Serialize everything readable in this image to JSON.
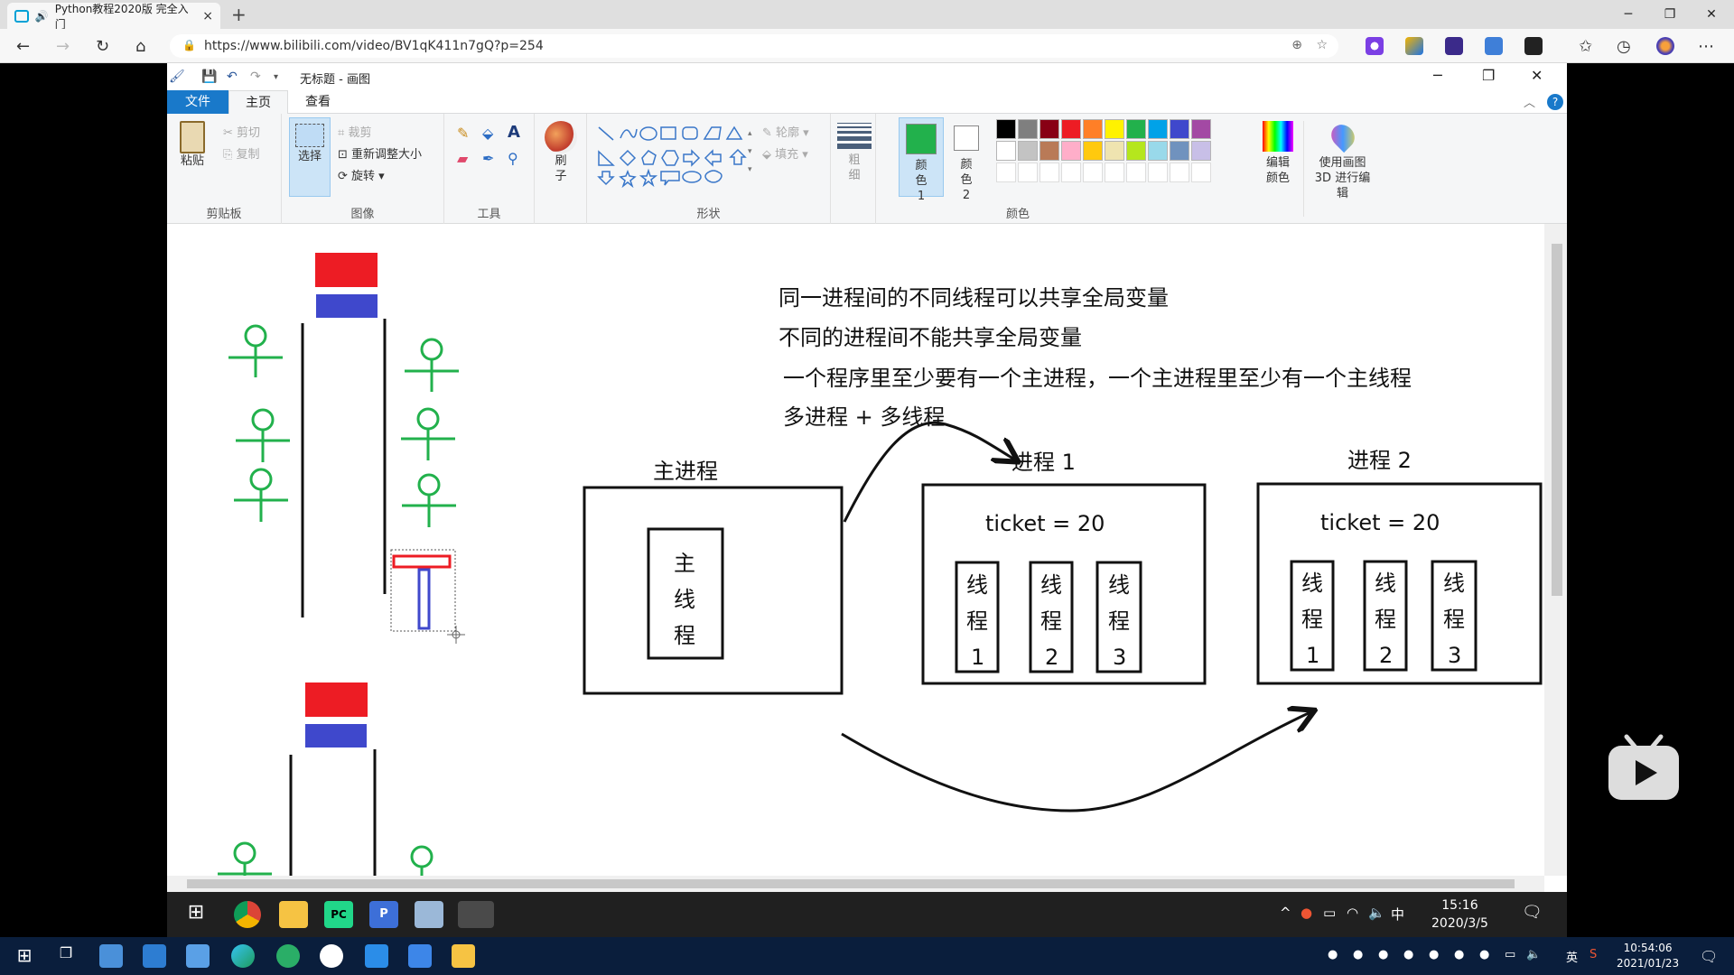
{
  "browser": {
    "tab_title": "Python教程2020版 完全入门",
    "tab_close": "×",
    "new_tab": "+",
    "url": "https://www.bilibili.com/video/BV1qK411n7gQ?p=254",
    "win_min": "─",
    "win_max": "❐",
    "win_close": "✕",
    "back": "←",
    "forward": "→",
    "refresh": "↻",
    "home": "⌂",
    "menu": "⋯"
  },
  "paint": {
    "doc_title": "无标题 - 画图",
    "menu": {
      "file": "文件",
      "home": "主页",
      "view": "查看"
    },
    "help": "?",
    "ribbon": {
      "clipboard": {
        "label": "剪贴板",
        "paste": "粘贴",
        "cut": "剪切",
        "copy": "复制"
      },
      "image": {
        "label": "图像",
        "select": "选择",
        "crop": "裁剪",
        "resize": "重新调整大小",
        "rotate": "旋转"
      },
      "tools": {
        "label": "工具"
      },
      "brushes": {
        "label": "刷子"
      },
      "shapes": {
        "label": "形状",
        "outline": "轮廓",
        "fill": "填充"
      },
      "size": {
        "label": "粗细"
      },
      "color1": "颜色 1",
      "color2": "颜色 2",
      "colors": {
        "label": "颜色",
        "edit": "编辑颜色"
      },
      "paint3d": "使用画图 3D 进行编辑"
    },
    "palette_row1": [
      "#000000",
      "#7f7f7f",
      "#880015",
      "#ed1c24",
      "#ff7f27",
      "#fff200",
      "#22b14c",
      "#00a2e8",
      "#3f48cc",
      "#a349a4"
    ],
    "palette_row2": [
      "#ffffff",
      "#c3c3c3",
      "#b97a57",
      "#ffaec9",
      "#ffc90e",
      "#efe4b0",
      "#b5e61d",
      "#99d9ea",
      "#7092be",
      "#c8bfe7"
    ],
    "color1_value": "#22b14c",
    "color2_value": "#ffffff"
  },
  "canvas": {
    "notes": [
      "同一进程间的不同线程可以共享全局变量",
      "不同的进程间不能共享全局变量",
      "一个程序里至少要有一个主进程，一个主进程里至少有一个主线程",
      "多进程 + 多线程"
    ],
    "main_process_label": "主进程",
    "main_thread_label": [
      "主",
      "线",
      "程"
    ],
    "process1_label": "进程 1",
    "process2_label": "进程 2",
    "ticket": "ticket = 20",
    "thread_label": [
      "线",
      "程"
    ],
    "thread_numbers": [
      "1",
      "2",
      "3"
    ]
  },
  "inner_taskbar": {
    "time": "15:16",
    "date": "2020/3/5",
    "ime": "中"
  },
  "outer_taskbar": {
    "time": "10:54:06",
    "date": "2021/01/23",
    "lang": "英"
  }
}
